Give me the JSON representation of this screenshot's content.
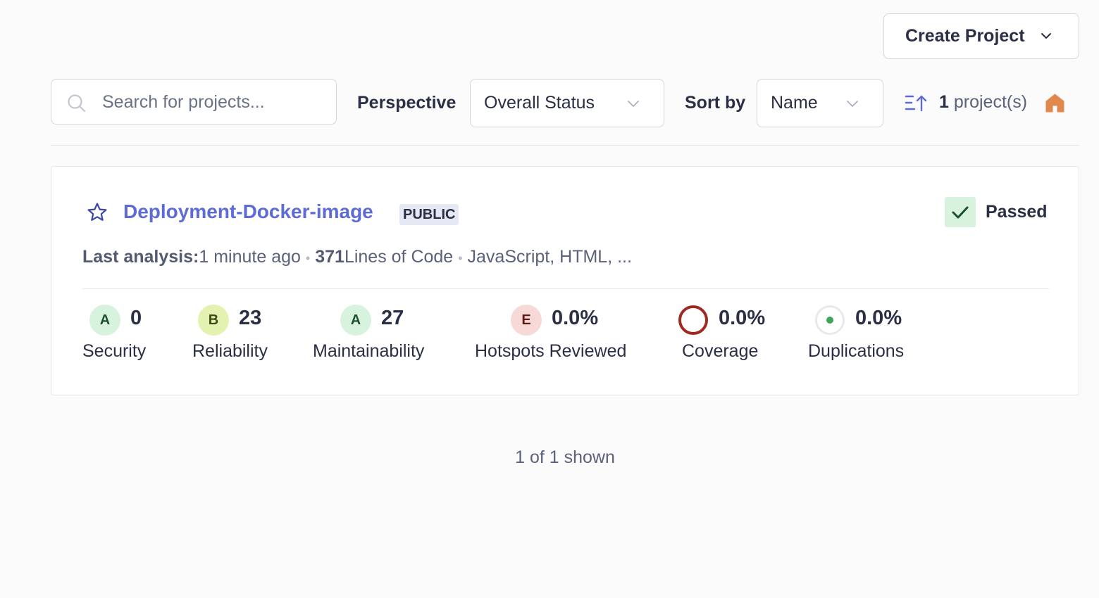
{
  "header": {
    "create_project_label": "Create Project"
  },
  "filters": {
    "search_placeholder": "Search for projects...",
    "search_value": "",
    "perspective_label": "Perspective",
    "perspective_value": "Overall Status",
    "sort_label": "Sort by",
    "sort_value": "Name",
    "count": "1",
    "count_suffix": " project(s)"
  },
  "project": {
    "name": "Deployment-Docker-image",
    "visibility": "PUBLIC",
    "status": "Passed",
    "last_analysis_label": "Last analysis:",
    "last_analysis_value": " 1 minute ago",
    "loc_value": "371",
    "loc_label": " Lines of Code",
    "languages": "JavaScript, HTML, ...",
    "metrics": {
      "security": {
        "rating": "A",
        "value": "0",
        "label": "Security"
      },
      "reliability": {
        "rating": "B",
        "value": "23",
        "label": "Reliability"
      },
      "maintainability": {
        "rating": "A",
        "value": "27",
        "label": "Maintainability"
      },
      "hotspots": {
        "rating": "E",
        "value": "0.0%",
        "label": "Hotspots Reviewed"
      },
      "coverage": {
        "value": "0.0%",
        "label": "Coverage"
      },
      "duplications": {
        "value": "0.0%",
        "label": "Duplications"
      }
    }
  },
  "footer": {
    "shown_text": "1 of 1 shown"
  },
  "colors": {
    "accent": "#5d6bd6",
    "rating_a_bg": "#d7f3dd",
    "rating_b_bg": "#e3f2b0",
    "rating_e_bg": "#f7d9d7",
    "passed_bg": "#d7f3dd",
    "coverage_ring": "#9e2a21",
    "home_icon": "#e0884d"
  },
  "icons": [
    "chevron-down-icon",
    "search-icon",
    "sort-ascending-icon",
    "home-icon",
    "star-icon",
    "check-icon",
    "coverage-ring-icon",
    "duplications-dot-icon"
  ]
}
